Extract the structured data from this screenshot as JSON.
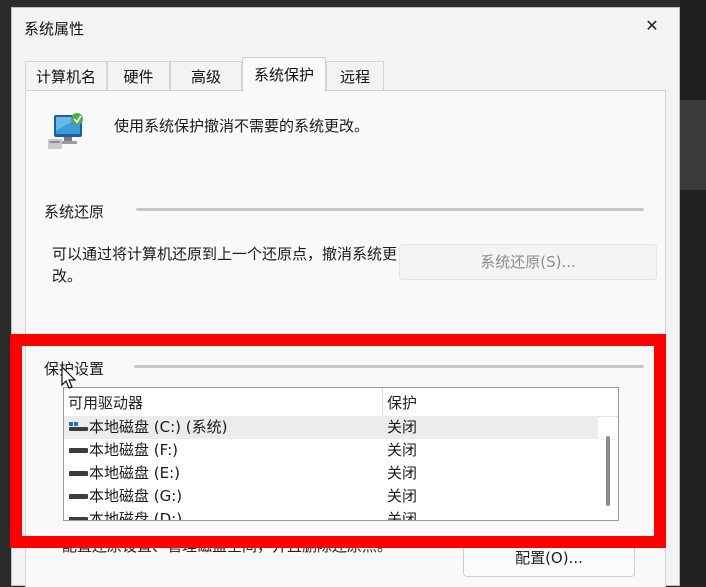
{
  "window": {
    "title": "系统属性",
    "close_label": "✕"
  },
  "tabs": [
    {
      "label": "计算机名"
    },
    {
      "label": "硬件"
    },
    {
      "label": "高级"
    },
    {
      "label": "系统保护",
      "active": true
    },
    {
      "label": "远程"
    }
  ],
  "intro_text": "使用系统保护撤消不需要的系统更改。",
  "restore": {
    "group_label": "系统还原",
    "description": "可以通过将计算机还原到上一个还原点，撤消系统更改。",
    "button_label": "系统还原(S)..."
  },
  "protection": {
    "group_label": "保护设置",
    "columns": [
      "可用驱动器",
      "保护"
    ],
    "drives": [
      {
        "name": "本地磁盘 (C:) (系统)",
        "protection": "关闭",
        "system": true,
        "selected": true
      },
      {
        "name": "本地磁盘 (F:)",
        "protection": "关闭"
      },
      {
        "name": "本地磁盘 (E:)",
        "protection": "关闭"
      },
      {
        "name": "本地磁盘 (G:)",
        "protection": "关闭"
      },
      {
        "name": "本地磁盘 (D:)",
        "protection": "关闭"
      }
    ],
    "configure_text": "配置还原设置、管理磁盘空间，并且删除还原点。",
    "configure_button": "配置(O)..."
  },
  "colors": {
    "highlight": "#ff0000",
    "accent": "#0078d4"
  }
}
